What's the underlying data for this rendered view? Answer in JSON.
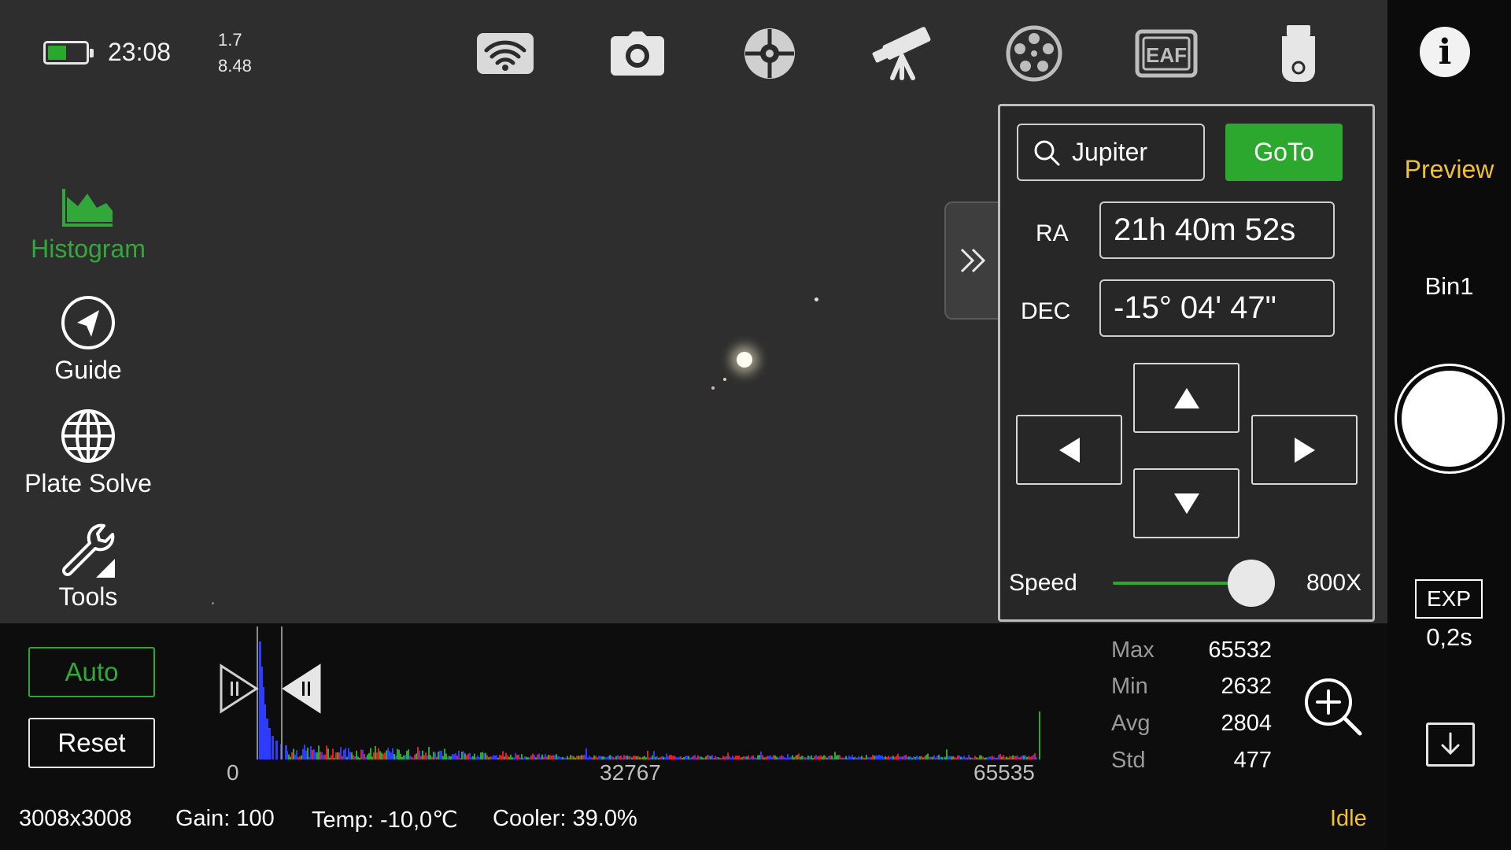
{
  "status_bar": {
    "battery_level": 0.5,
    "time": "23:08",
    "stat_line1": "1.7",
    "stat_line2": "8.48"
  },
  "top_icons": [
    "wifi-icon",
    "camera-icon",
    "guide-scope-icon",
    "telescope-icon",
    "filter-wheel-icon",
    "eaf-focuser-icon",
    "usb-storage-icon"
  ],
  "eaf_text": "EAF",
  "left_menu": {
    "histogram": "Histogram",
    "guide": "Guide",
    "plate_solve": "Plate Solve",
    "tools": "Tools"
  },
  "mount_panel": {
    "search_value": "Jupiter",
    "goto_label": "GoTo",
    "ra_label": "RA",
    "ra_value": "21h 40m 52s",
    "dec_label": "DEC",
    "dec_value": "-15° 04' 47\"",
    "speed_label": "Speed",
    "speed_value": "800X",
    "speed_level": 0.9
  },
  "right_bar": {
    "preview": "Preview",
    "bin": "Bin1",
    "exp_label": "EXP",
    "exp_value": "0,2s"
  },
  "histogram": {
    "auto_label": "Auto",
    "reset_label": "Reset",
    "tick_min": "0",
    "tick_mid": "32767",
    "tick_max": "65535",
    "stats": [
      {
        "label": "Max",
        "value": "65532"
      },
      {
        "label": "Min",
        "value": "2632"
      },
      {
        "label": "Avg",
        "value": "2804"
      },
      {
        "label": "Std",
        "value": "477"
      }
    ]
  },
  "bottom_status": {
    "resolution": "3008x3008",
    "gain": "Gain: 100",
    "temp": "Temp: -10,0℃",
    "cooler": "Cooler: 39.0%",
    "state": "Idle"
  },
  "colors": {
    "accent_green": "#2ca82f",
    "highlight_yellow": "#f2c12e"
  }
}
